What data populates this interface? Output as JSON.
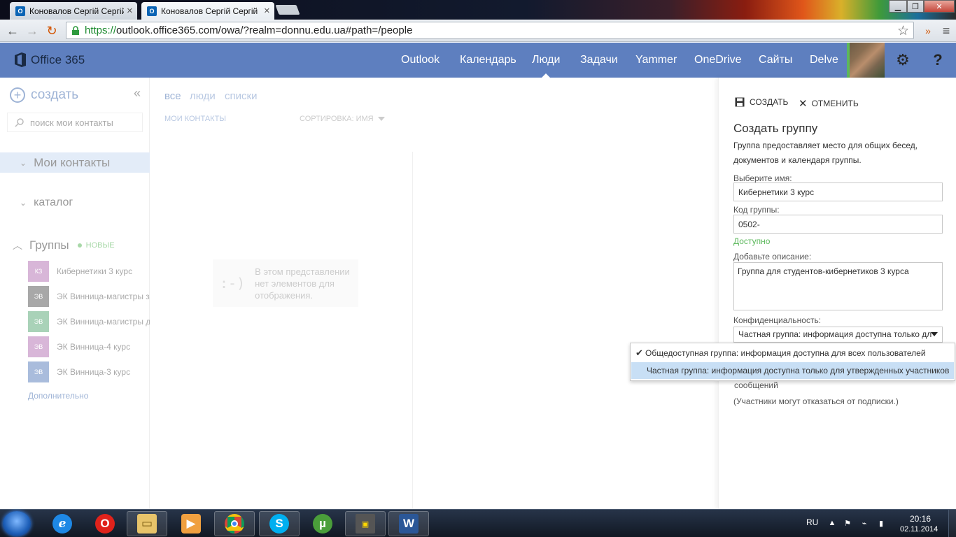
{
  "browser": {
    "tabs": [
      {
        "title": "Коновалов Сергій Сергій",
        "active": false
      },
      {
        "title": "Коновалов Сергій Сергій",
        "active": true
      }
    ],
    "url_scheme": "https://",
    "url_rest": "outlook.office365.com/owa/?realm=donnu.edu.ua#path=/people"
  },
  "suite": {
    "logo": "Office 365",
    "nav": [
      "Outlook",
      "Календарь",
      "Люди",
      "Задачи",
      "Yammer",
      "OneDrive",
      "Сайты",
      "Delve"
    ],
    "active_nav": "Люди"
  },
  "left": {
    "create_label": "создать",
    "search_placeholder": "поиск мои контакты",
    "my_contacts": "Мои контакты",
    "catalog": "каталог",
    "groups": "Группы",
    "new_badge": "НОВЫЕ",
    "group_items": [
      {
        "initials": "КЗ",
        "name": "Кибернетики 3 курс",
        "color": "#d8b6d8"
      },
      {
        "initials": "ЭВ",
        "name": "ЭК Винница-магистры за",
        "color": "#a8a8a8"
      },
      {
        "initials": "ЭВ",
        "name": "ЭК Винница-магистры д",
        "color": "#a9d2b8"
      },
      {
        "initials": "ЭВ",
        "name": "ЭК Винница-4 курс",
        "color": "#d8b6d8"
      },
      {
        "initials": "ЭВ",
        "name": "ЭК Винница-3 курс",
        "color": "#a9bcdc"
      }
    ],
    "more": "Дополнительно"
  },
  "middle": {
    "filters": [
      "все",
      "люди",
      "списки"
    ],
    "my_contacts_label": "МОИ КОНТАКТЫ",
    "sort_label": "СОРТИРОВКА: ИМЯ",
    "empty_face": ":-)",
    "empty_text": "В этом представлении нет элементов для отображения."
  },
  "form": {
    "save_label": "СОЗДАТЬ",
    "cancel_label": "ОТМЕНИТЬ",
    "title": "Создать группу",
    "description": "Группа предоставляет место для общих бесед, документов и календаря группы.",
    "name_label": "Выберите имя:",
    "name_value": "Кибернетики 3 курс",
    "code_label": "Код группы:",
    "code_value": "0502-",
    "available": "Доступно",
    "desc_label": "Добавьте описание:",
    "desc_value": "Группа для студентов-кибернетиков 3 курса",
    "privacy_label": "Конфиденциальность:",
    "privacy_value": "Частная группа: информация доступна только дл",
    "subscribe_tail": "сообщений",
    "unsubscribe_note": "(Участники могут отказаться от подписки.)"
  },
  "dropdown": {
    "options": [
      {
        "label": "Общедоступная группа: информация доступна для всех пользователей",
        "checked": true
      },
      {
        "label": "Частная группа: информация доступна только для утвержденных участников",
        "highlighted": true
      }
    ]
  },
  "taskbar": {
    "lang": "RU",
    "time": "20:16",
    "date": "02.11.2014"
  },
  "colors": {
    "suite_bar": "#5e7fbf",
    "accent_light": "#9fb4d6",
    "available_green": "#5cb85c",
    "highlight": "#c8dff5"
  }
}
